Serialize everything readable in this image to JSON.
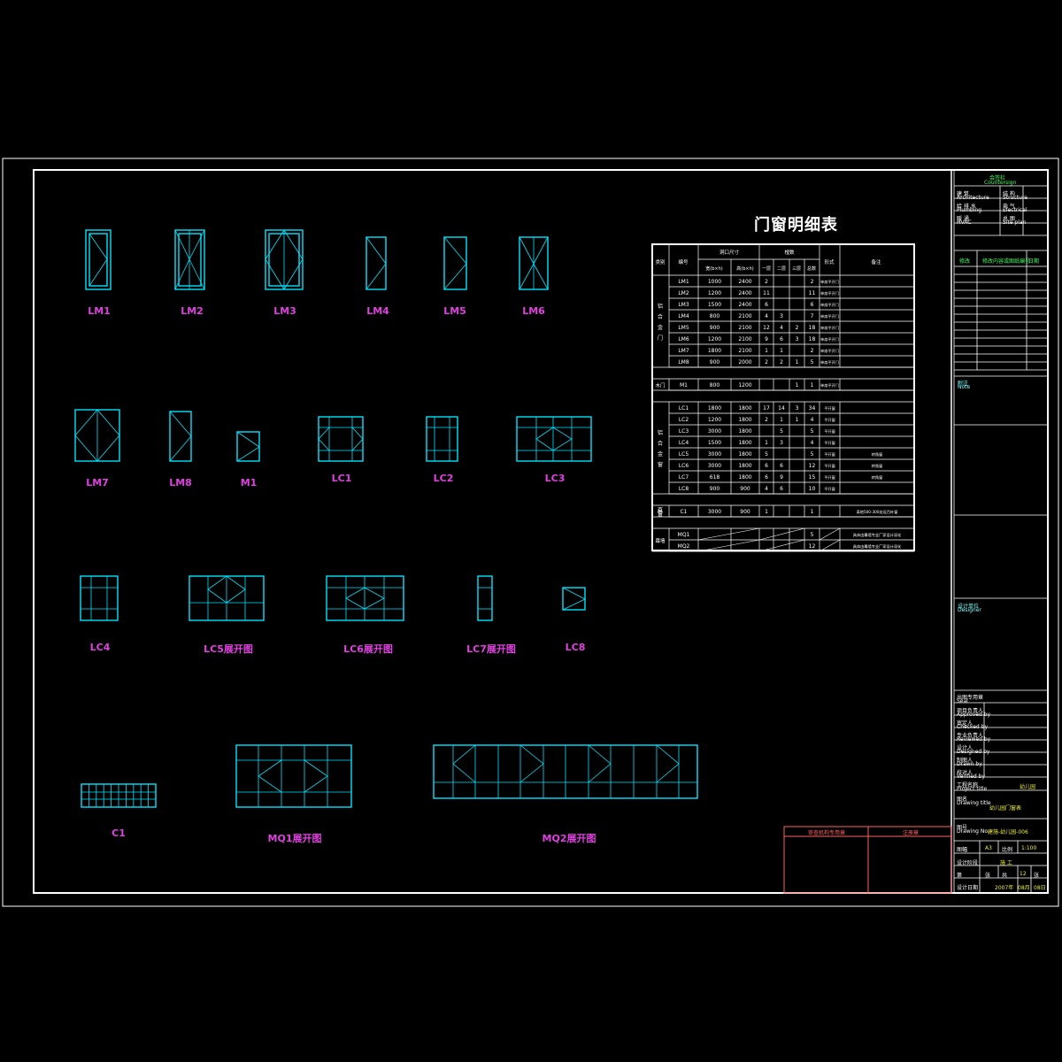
{
  "title": "门窗明细表",
  "labels": {
    "lm1": "LM1",
    "lm2": "LM2",
    "lm3": "LM3",
    "lm4": "LM4",
    "lm5": "LM5",
    "lm6": "LM6",
    "lm7": "LM7",
    "lm8": "LM8",
    "m1": "M1",
    "lc1": "LC1",
    "lc2": "LC2",
    "lc3": "LC3",
    "lc4": "LC4",
    "lc5": "LC5展开图",
    "lc6": "LC6展开图",
    "lc7": "LC7展开图",
    "lc8": "LC8",
    "c1": "C1",
    "mq1": "MQ1展开图",
    "mq2": "MQ2展开图"
  },
  "table": {
    "headers": {
      "category": "类别",
      "code": "编号",
      "size": "洞口尺寸",
      "width": "宽(b×h)",
      "height": "高(b×h)",
      "count": "樘数",
      "f1": "一层",
      "f2": "二层",
      "f3": "三层",
      "total": "总数",
      "type": "形式",
      "remark": "备注"
    },
    "groups": [
      {
        "name": "铝合金门",
        "rows": [
          [
            "LM1",
            "1000",
            "2400",
            "2",
            "",
            "",
            "2",
            "单扇平开门",
            ""
          ],
          [
            "LM2",
            "1200",
            "2400",
            "11",
            "",
            "",
            "11",
            "单扇平开门",
            ""
          ],
          [
            "LM3",
            "1500",
            "2400",
            "6",
            "",
            "",
            "6",
            "单扇平开门",
            ""
          ],
          [
            "LM4",
            "800",
            "2100",
            "4",
            "3",
            "",
            "7",
            "单扇平开门",
            ""
          ],
          [
            "LM5",
            "900",
            "2100",
            "12",
            "4",
            "2",
            "18",
            "单扇平开门",
            ""
          ],
          [
            "LM6",
            "1200",
            "2100",
            "9",
            "6",
            "3",
            "18",
            "单扇平开门",
            ""
          ],
          [
            "LM7",
            "1800",
            "2100",
            "1",
            "1",
            "",
            "2",
            "单扇平开门",
            ""
          ],
          [
            "LM8",
            "900",
            "2000",
            "2",
            "2",
            "1",
            "5",
            "单扇平开门",
            ""
          ]
        ]
      },
      {
        "name": "木门",
        "rows": [
          [
            "M1",
            "800",
            "1200",
            "",
            "",
            "1",
            "1",
            "单扇平开门",
            ""
          ]
        ]
      },
      {
        "name": "铝合金窗",
        "rows": [
          [
            "LC1",
            "1800",
            "1800",
            "17",
            "14",
            "3",
            "34",
            "平开窗",
            ""
          ],
          [
            "LC2",
            "1200",
            "1800",
            "2",
            "1",
            "1",
            "4",
            "平开窗",
            ""
          ],
          [
            "LC3",
            "3000",
            "1800",
            "",
            "5",
            "",
            "5",
            "平开窗",
            ""
          ],
          [
            "LC4",
            "1500",
            "1800",
            "1",
            "3",
            "",
            "4",
            "平开窗",
            ""
          ],
          [
            "LC5",
            "3000",
            "1800",
            "5",
            "",
            "",
            "5",
            "平开窗",
            "转角窗"
          ],
          [
            "LC6",
            "3000",
            "1800",
            "6",
            "6",
            "",
            "12",
            "平开窗",
            "转角窗"
          ],
          [
            "LC7",
            "618",
            "1800",
            "6",
            "9",
            "",
            "15",
            "平开窗",
            "转角窗"
          ],
          [
            "LC8",
            "900",
            "900",
            "4",
            "6",
            "",
            "10",
            "平开窗",
            ""
          ]
        ]
      },
      {
        "name": "百叶窗",
        "rows": [
          [
            "C1",
            "3000",
            "900",
            "1",
            "",
            "",
            "1",
            "",
            "离地500-300处设百叶窗"
          ]
        ]
      },
      {
        "name": "幕墙",
        "rows": [
          [
            "MQ1",
            "",
            "",
            "",
            "",
            "",
            "5",
            "",
            "具体由幕墙专业厂家设计深化"
          ],
          [
            "MQ2",
            "",
            "",
            "",
            "",
            "",
            "12",
            "",
            "具体由幕墙专业厂家设计深化"
          ]
        ]
      }
    ]
  },
  "titleblock": {
    "top": "会签栏",
    "top_en": "Countersign",
    "f1": "建 筑",
    "f1_en": "Architecture",
    "f2": "结 构",
    "f2_en": "Structure",
    "f3": "给 排 水",
    "f3_en": "Plumbing",
    "f4": "电 气",
    "f4_en": "Electrical",
    "f5": "暖 通",
    "f5_en": "HVAC",
    "f6": "总 图",
    "f6_en": "Site plan",
    "rev_no": "修改",
    "rev_content": "修改内容或图纸编号",
    "rev_date": "日期",
    "notes": "附注",
    "notes_en": "Note",
    "designer_org": "设计单位",
    "designer_org_en": "Designer",
    "seal": "出图专用章",
    "seal_en": "Seal",
    "approved": "项目负责人",
    "approved_en": "Approved by",
    "checked": "审定人",
    "checked_en": "Checked by",
    "reviewer": "专业负责人",
    "reviewer_en": "Reviewed by",
    "designer": "设计人",
    "designer_en": "Designed by",
    "drawn": "制图人",
    "drawn_en": "Drawn by",
    "verifier": "校对人",
    "verifier_en": "Verified by",
    "project_label": "工程名称",
    "project_label_en": "Project title",
    "project_value": "幼儿园",
    "drawing_label": "图名",
    "drawing_label_en": "Drawing title",
    "drawing_value": "幼儿园门窗表",
    "no_label": "图号",
    "no_label_en": "Drawing No.",
    "no_value": "建施-幼儿园-006",
    "size_label": "图幅",
    "size_value": "A3",
    "scale_label": "比例",
    "scale_value": "1:100",
    "stage_label": "设计阶段",
    "stage_value": "施 工",
    "page_label": "第",
    "page_value": "张",
    "total_label": "共",
    "total_value": "12",
    "total_unit": "张",
    "date_label": "设计日期",
    "date_value": "2007年",
    "date_m": "08月",
    "date_d": "08日"
  },
  "stamp": {
    "left": "审查机构专用章",
    "right": "注册章"
  }
}
